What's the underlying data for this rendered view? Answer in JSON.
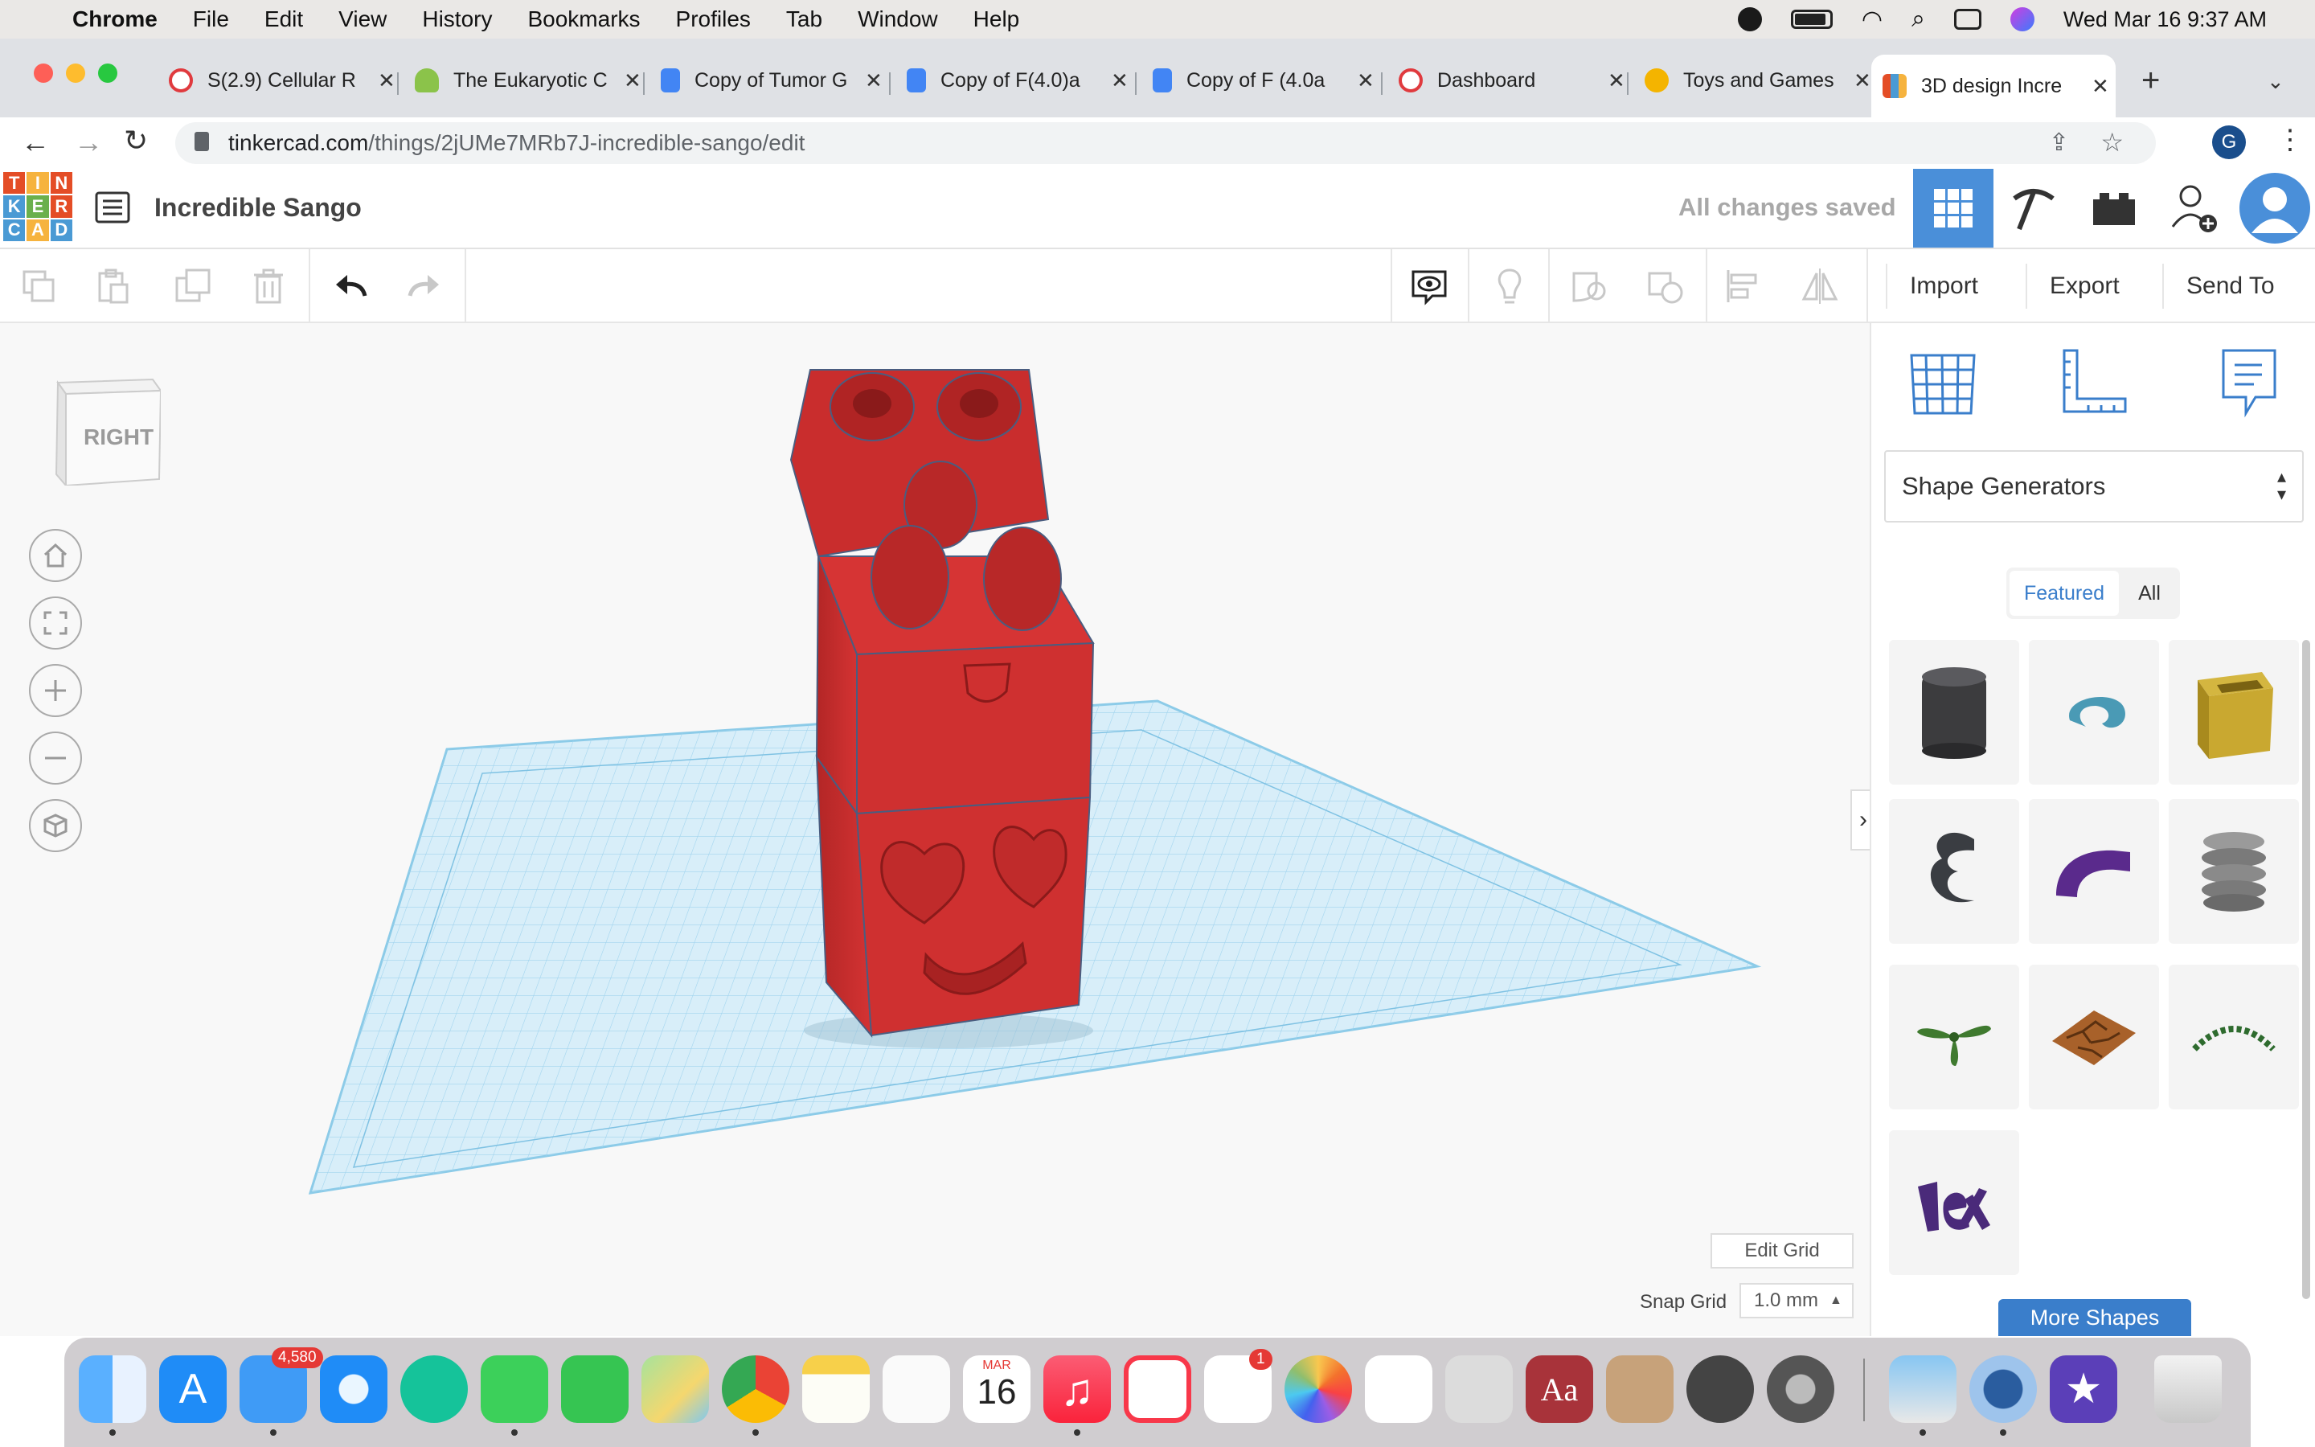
{
  "menubar": {
    "app": "Chrome",
    "items": [
      "File",
      "Edit",
      "View",
      "History",
      "Bookmarks",
      "Profiles",
      "Tab",
      "Window",
      "Help"
    ],
    "clock": "Wed Mar 16  9:37 AM"
  },
  "tabs": [
    {
      "title": "S(2.9) Cellular R",
      "favicon": "canvas-icon",
      "color": "#e03a3e"
    },
    {
      "title": "The Eukaryotic C",
      "favicon": "cloud-leaf-icon",
      "color": "#8bc34a"
    },
    {
      "title": "Copy of Tumor G",
      "favicon": "docs-icon",
      "color": "#4285f4"
    },
    {
      "title": "Copy of F(4.0)a",
      "favicon": "docs-icon",
      "color": "#4285f4"
    },
    {
      "title": "Copy of F (4.0a",
      "favicon": "docs-icon",
      "color": "#4285f4"
    },
    {
      "title": "Dashboard",
      "favicon": "canvas-icon",
      "color": "#e03a3e"
    },
    {
      "title": "Toys and Games",
      "favicon": "toy-icon",
      "color": "#f4b400"
    },
    {
      "title": "3D design Incre",
      "favicon": "tinkercad-icon",
      "color": "#e44d26"
    }
  ],
  "address": {
    "host": "tinkercad.com",
    "path": "/things/2jUMe7MRb7J-incredible-sango/edit",
    "profile_initial": "G"
  },
  "tinkercad": {
    "logo_letters": [
      "T",
      "I",
      "N",
      "K",
      "E",
      "R",
      "C",
      "A",
      "D"
    ],
    "design_title": "Incredible Sango",
    "save_status": "All changes saved"
  },
  "toolbar": {
    "import_label": "Import",
    "export_label": "Export",
    "send_to_label": "Send To"
  },
  "workplane": {
    "view_cube_label": "RIGHT",
    "edit_grid_label": "Edit Grid",
    "snap_grid_label": "Snap Grid",
    "snap_grid_value": "1.0 mm"
  },
  "panel": {
    "library_select": "Shape Generators",
    "tab_featured": "Featured",
    "tab_all": "All",
    "more_shapes_label": "More Shapes"
  },
  "dock": {
    "mail_badge": "4,580",
    "calendar_month": "MAR",
    "calendar_day": "16",
    "reminders_badge": "1"
  }
}
